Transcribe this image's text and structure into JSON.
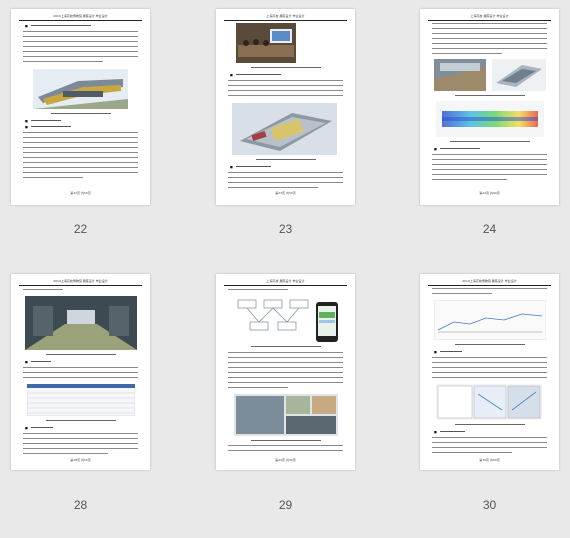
{
  "viewer": {
    "background": "#e9e9e9"
  },
  "pages": [
    {
      "number": "22",
      "header": "2019上海高校博物馆 展陈设计  毕业设计",
      "footer": "第22页 共50页",
      "watermark": "上海..."
    },
    {
      "number": "23",
      "header": "上海高校 展陈设计  毕业设计",
      "footer": "第23页 共50页",
      "watermark": "上海..."
    },
    {
      "number": "24",
      "header": "上海高校 展陈设计  毕业设计",
      "footer": "第24页 共50页",
      "watermark": "上海..."
    },
    {
      "number": "28",
      "header": "2019上海高校博物馆 展陈设计  毕业设计",
      "footer": "第28页 共50页",
      "watermark": "上海..."
    },
    {
      "number": "29",
      "header": "上海高校 展陈设计  毕业设计",
      "footer": "第29页 共50页",
      "watermark": "上海..."
    },
    {
      "number": "30",
      "header": "2019上海高校博物馆 展陈设计  毕业设计",
      "footer": "第30页 共50页",
      "watermark": "上海..."
    }
  ]
}
